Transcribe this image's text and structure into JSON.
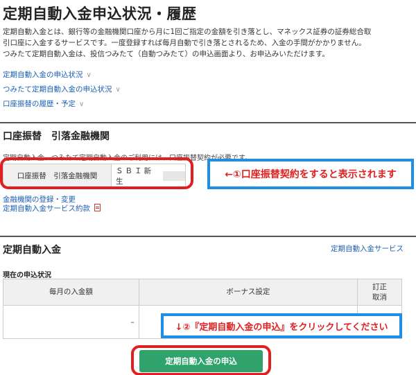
{
  "page_title": "定期自動入金申込状況・履歴",
  "intro": [
    "定期自動入金とは、銀行等の金融機関口座から月に1回ご指定の金額を引き落とし、マネックス証券の証券総合取",
    "引口座に入金するサービスです。一度登録すれば毎月自動で引き落とされるため、入金の手間がかかりません。",
    "つみたて定期自動入金は、投信つみたて（自動つみたて）の申込画面より、お申込みいただけます。"
  ],
  "anchor_links": [
    {
      "label": "定期自動入金の申込状況",
      "icon": "chevron-down-icon"
    },
    {
      "label": "つみたて定期自動入金の申込状況",
      "icon": "chevron-down-icon"
    },
    {
      "label": "口座振替の履歴・予定",
      "icon": "chevron-down-icon"
    }
  ],
  "bank_section": {
    "title": "口座振替　引落金融機関",
    "note": "定期自動入金、つみたて定期自動入金のご利用には、口座振替契約が必要です。",
    "row_label": "口座振替　引落金融機関",
    "row_value": "ＳＢＩ新生",
    "register_link": "金融機関の登録・変更",
    "terms_link": "定期自動入金サービス約款"
  },
  "callouts": {
    "first": "←①口座振替契約をすると表示されます",
    "second": "↓②『定期自動入金の申込』をクリックしてください"
  },
  "auto_deposit": {
    "title": "定期自動入金",
    "service_link": "定期自動入金サービス",
    "status_label": "現在の申込状況",
    "columns": [
      "毎月の入金額",
      "ボーナス設定",
      "訂正",
      "取消"
    ],
    "row": {
      "monthly": "–",
      "bonus": "",
      "action": ""
    },
    "apply_button": "定期自動入金の申込"
  },
  "colors": {
    "link": "#1a5fb4",
    "callout_border_red": "#e02020",
    "callout_border_blue": "#1e8fe6",
    "callout_text": "#e02020",
    "apply_button": "#2fa36b"
  }
}
